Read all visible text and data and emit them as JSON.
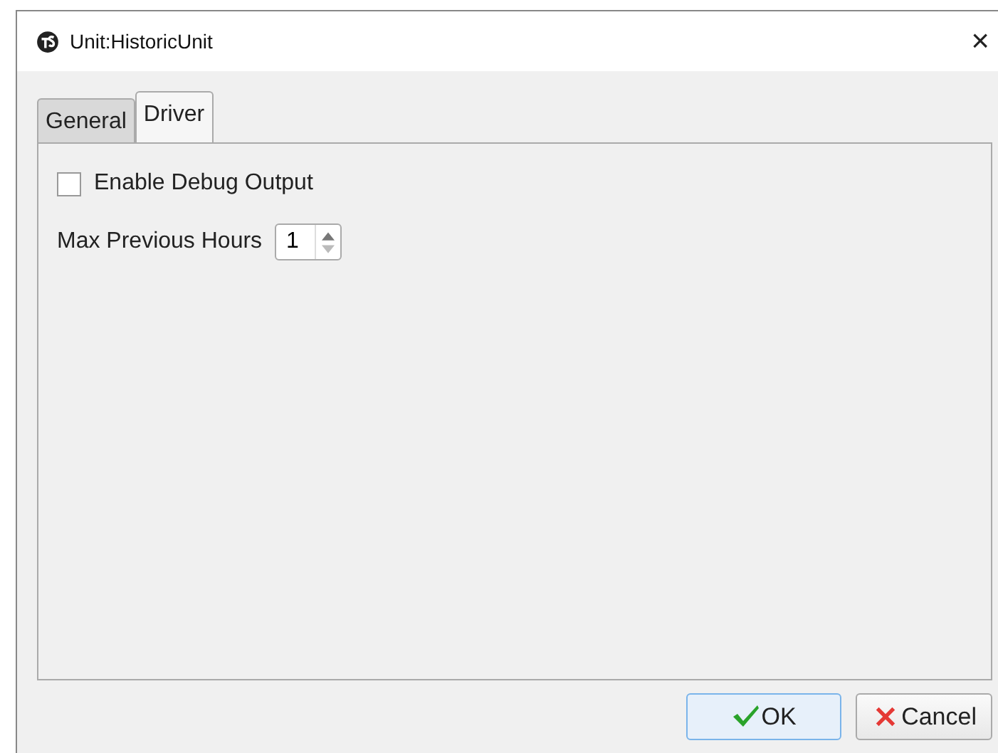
{
  "window": {
    "title": "Unit:HistoricUnit",
    "close": "×"
  },
  "tabs": [
    {
      "label": "General",
      "selected": false
    },
    {
      "label": "Driver",
      "selected": true
    }
  ],
  "options": [
    {
      "kind": "checkbox",
      "label": "Enable Debug Output",
      "checked": false
    },
    {
      "kind": "spinner",
      "label": "Max Previous Hours",
      "value": "1"
    }
  ],
  "buttons": [
    {
      "kind": "ok",
      "label": "OK",
      "selected": true
    },
    {
      "kind": "cancel",
      "label": "Cancel",
      "selected": false
    }
  ]
}
